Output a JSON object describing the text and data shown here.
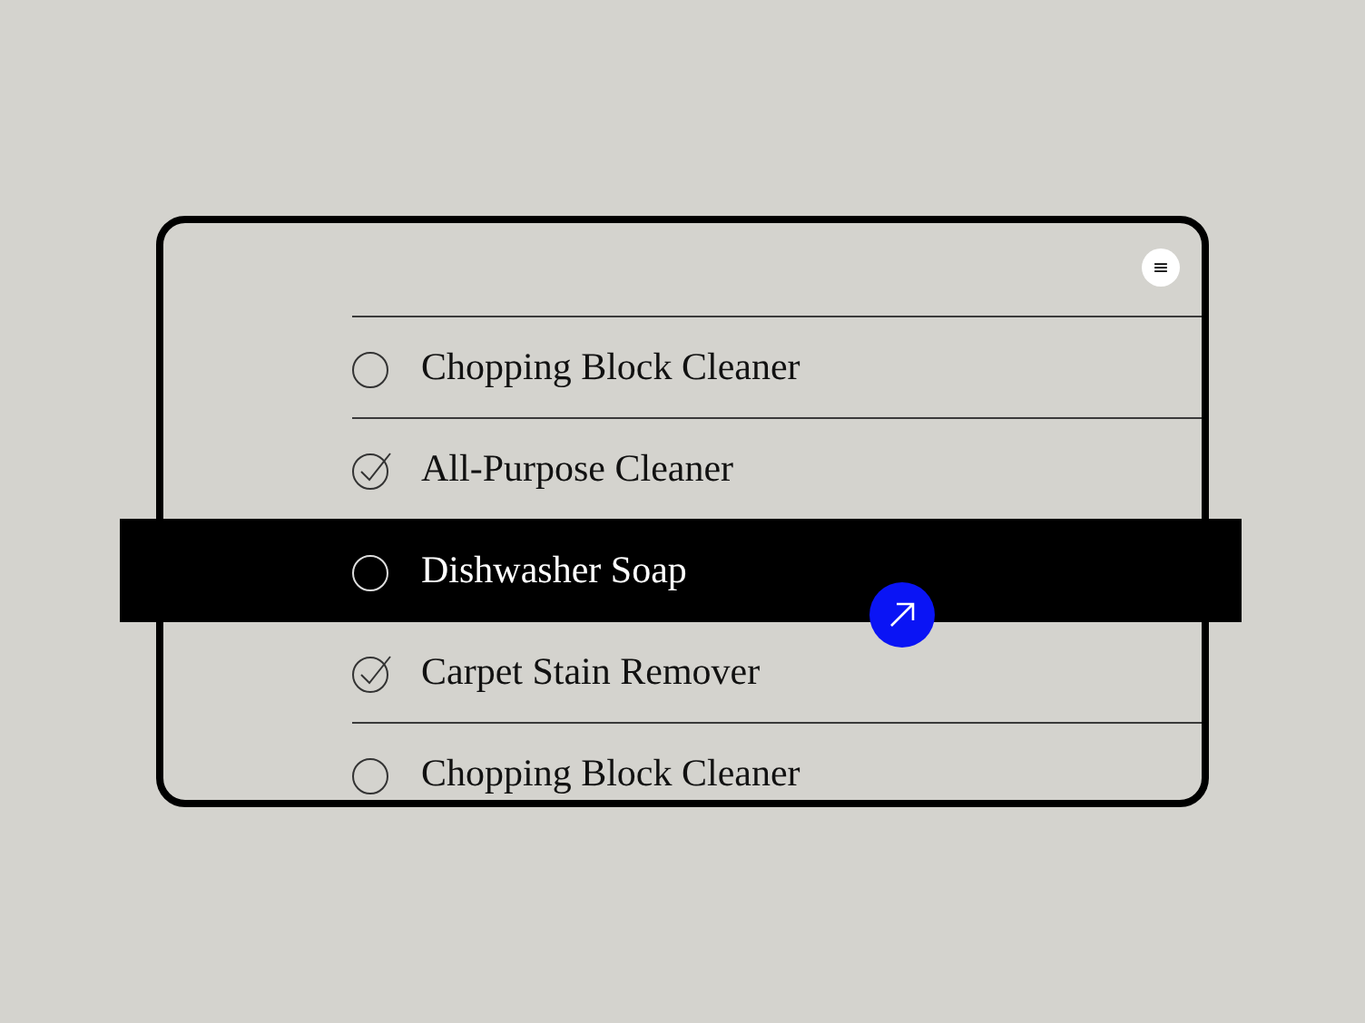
{
  "menu_button": {
    "label": "≡"
  },
  "items": [
    {
      "label": "Chopping Block Cleaner",
      "checked": false,
      "selected": false
    },
    {
      "label": "All-Purpose Cleaner",
      "checked": true,
      "selected": false
    },
    {
      "label": "Dishwasher Soap",
      "checked": false,
      "selected": true
    },
    {
      "label": "Carpet Stain Remover",
      "checked": true,
      "selected": false
    },
    {
      "label": "Chopping Block Cleaner",
      "checked": false,
      "selected": false
    }
  ]
}
